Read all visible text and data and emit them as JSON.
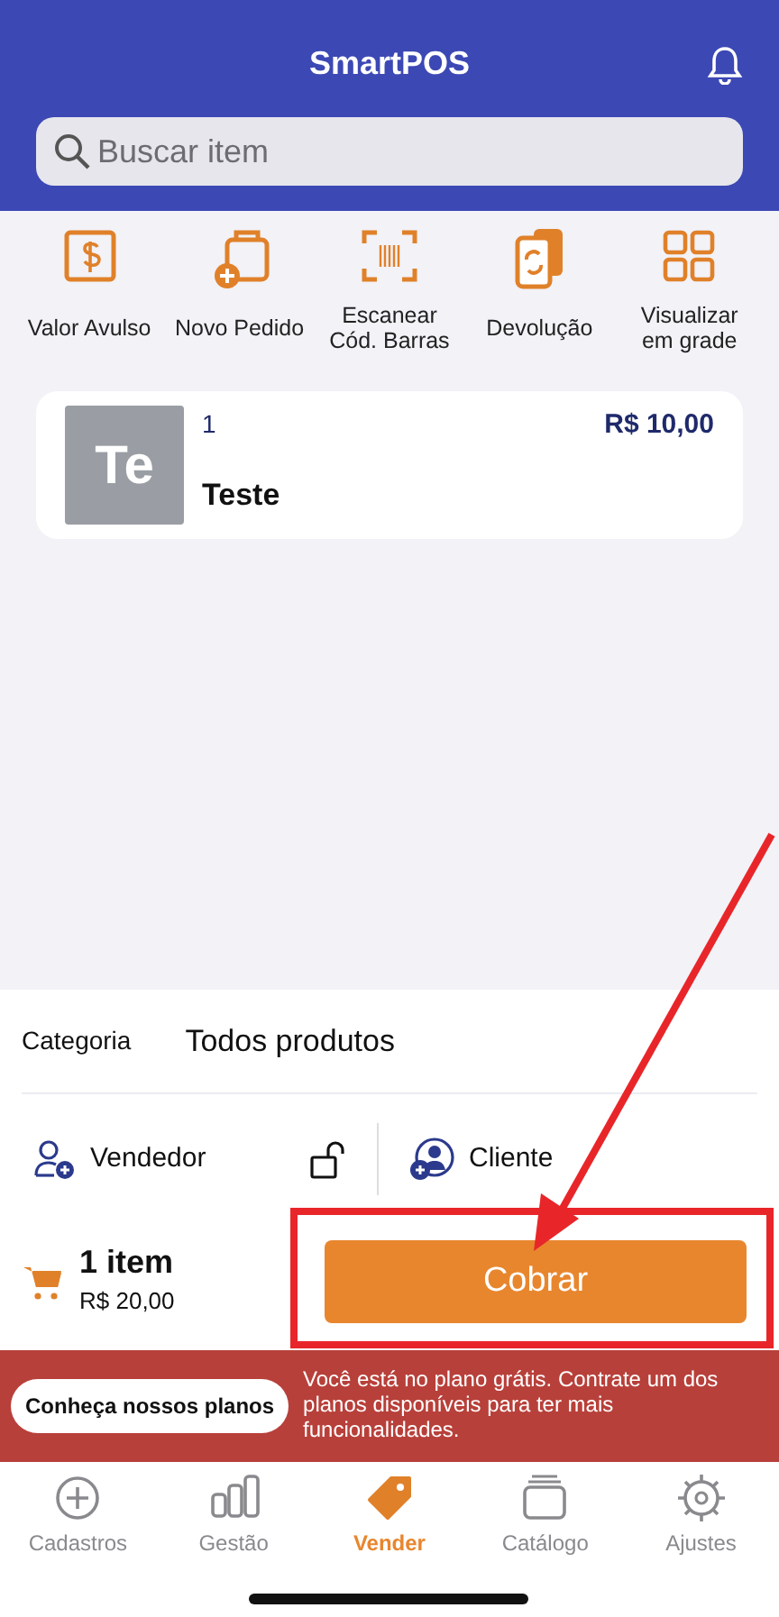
{
  "header": {
    "title": "SmartPOS"
  },
  "search": {
    "placeholder": "Buscar item"
  },
  "quick_actions": [
    {
      "kind": "dollar",
      "label": "Valor Avulso"
    },
    {
      "kind": "new-order",
      "label": "Novo Pedido"
    },
    {
      "kind": "barcode",
      "label": "Escanear Cód. Barras"
    },
    {
      "kind": "return",
      "label": "Devolução"
    },
    {
      "kind": "grid",
      "label": "Visualizar em grade"
    }
  ],
  "cart_items": [
    {
      "initials": "Te",
      "quantity": "1",
      "price": "R$ 10,00",
      "name": "Teste"
    }
  ],
  "category": {
    "label": "Categoria",
    "value": "Todos produtos"
  },
  "seller": {
    "label": "Vendedor",
    "locked": false
  },
  "customer": {
    "label": "Cliente"
  },
  "summary": {
    "count": "1 item",
    "total": "R$ 20,00",
    "button": "Cobrar"
  },
  "plan_banner": {
    "button": "Conheça nossos planos",
    "message": "Você está no plano grátis. Contrate um dos planos disponíveis para ter mais funcionalidades."
  },
  "tabs": [
    {
      "kind": "plus",
      "label": "Cadastros",
      "selected": false
    },
    {
      "kind": "bars",
      "label": "Gestão",
      "selected": false
    },
    {
      "kind": "tag",
      "label": "Vender",
      "selected": true
    },
    {
      "kind": "stack",
      "label": "Catálogo",
      "selected": false
    },
    {
      "kind": "gear",
      "label": "Ajustes",
      "selected": false
    }
  ]
}
